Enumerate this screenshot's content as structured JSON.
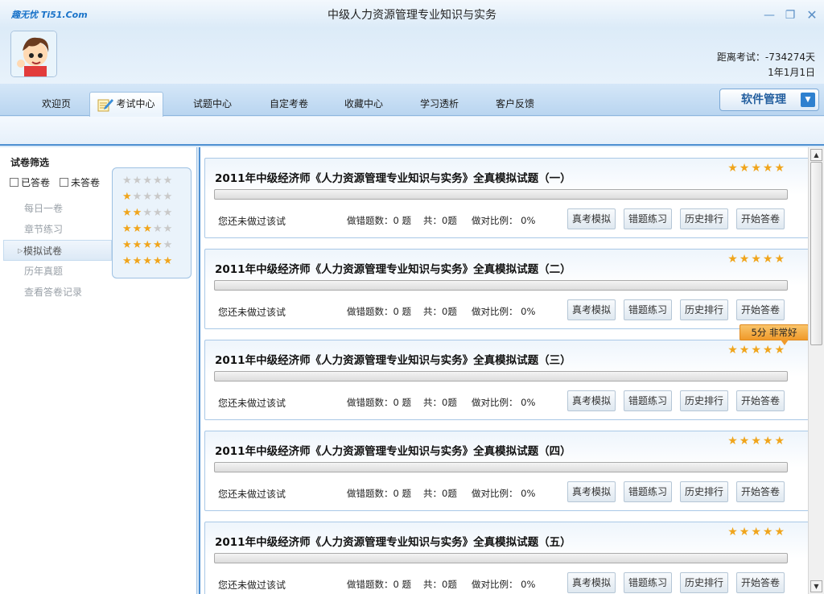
{
  "window": {
    "brand": "趣无忧 Ti51.Com",
    "title": "中级人力资源管理专业知识与实务"
  },
  "header": {
    "countdown_label": "距离考试：-734274天",
    "exam_date": "1年1月1日"
  },
  "nav": {
    "tabs": [
      {
        "label": "欢迎页",
        "active": false
      },
      {
        "label": "考试中心",
        "active": true,
        "icon": "pencil-notepad-icon"
      },
      {
        "label": "试题中心",
        "active": false
      },
      {
        "label": "自定考卷",
        "active": false
      },
      {
        "label": "收藏中心",
        "active": false
      },
      {
        "label": "学习透析",
        "active": false
      },
      {
        "label": "客户反馈",
        "active": false
      }
    ],
    "software_menu": "软件管理"
  },
  "sidebar": {
    "filter_title": "试卷筛选",
    "checkbox_answered": "已答卷",
    "checkbox_unanswered": "未答卷",
    "star_filter_levels": [
      0,
      1,
      2,
      3,
      4,
      5
    ],
    "menu": [
      {
        "label": "每日一卷",
        "active": false
      },
      {
        "label": "章节练习",
        "active": false
      },
      {
        "label": "模拟试卷",
        "active": true
      },
      {
        "label": "历年真题",
        "active": false
      },
      {
        "label": "查看答卷记录",
        "active": false
      }
    ]
  },
  "papers": [
    {
      "title": "2011年中级经济师《人力资源管理专业知识与实务》全真模拟试题（一）",
      "rating": 5,
      "progress": 0,
      "status": "您还未做过该试",
      "wrong": "做错题数：0 题",
      "total": "共：0题",
      "ratio": "做对比例： 0%"
    },
    {
      "title": "2011年中级经济师《人力资源管理专业知识与实务》全真模拟试题（二）",
      "rating": 5,
      "progress": 0,
      "status": "您还未做过该试",
      "wrong": "做错题数：0 题",
      "total": "共：0题",
      "ratio": "做对比例： 0%"
    },
    {
      "title": "2011年中级经济师《人力资源管理专业知识与实务》全真模拟试题（三）",
      "rating": 5,
      "progress": 0,
      "status": "您还未做过该试",
      "wrong": "做错题数：0 题",
      "total": "共：0题",
      "ratio": "做对比例： 0%",
      "tooltip": "5分 非常好"
    },
    {
      "title": "2011年中级经济师《人力资源管理专业知识与实务》全真模拟试题（四）",
      "rating": 5,
      "progress": 0,
      "status": "您还未做过该试",
      "wrong": "做错题数：0 题",
      "total": "共：0题",
      "ratio": "做对比例： 0%"
    },
    {
      "title": "2011年中级经济师《人力资源管理专业知识与实务》全真模拟试题（五）",
      "rating": 5,
      "progress": 0,
      "status": "您还未做过该试",
      "wrong": "做错题数：0 题",
      "total": "共：0题",
      "ratio": "做对比例： 0%"
    }
  ],
  "card_buttons": [
    "真考模拟",
    "错题练习",
    "历史排行",
    "开始答卷"
  ],
  "colors": {
    "accent": "#4e90d2",
    "star_on": "#f0a51c",
    "star_off": "#c9c9c9",
    "tooltip": "#f09a2a"
  }
}
